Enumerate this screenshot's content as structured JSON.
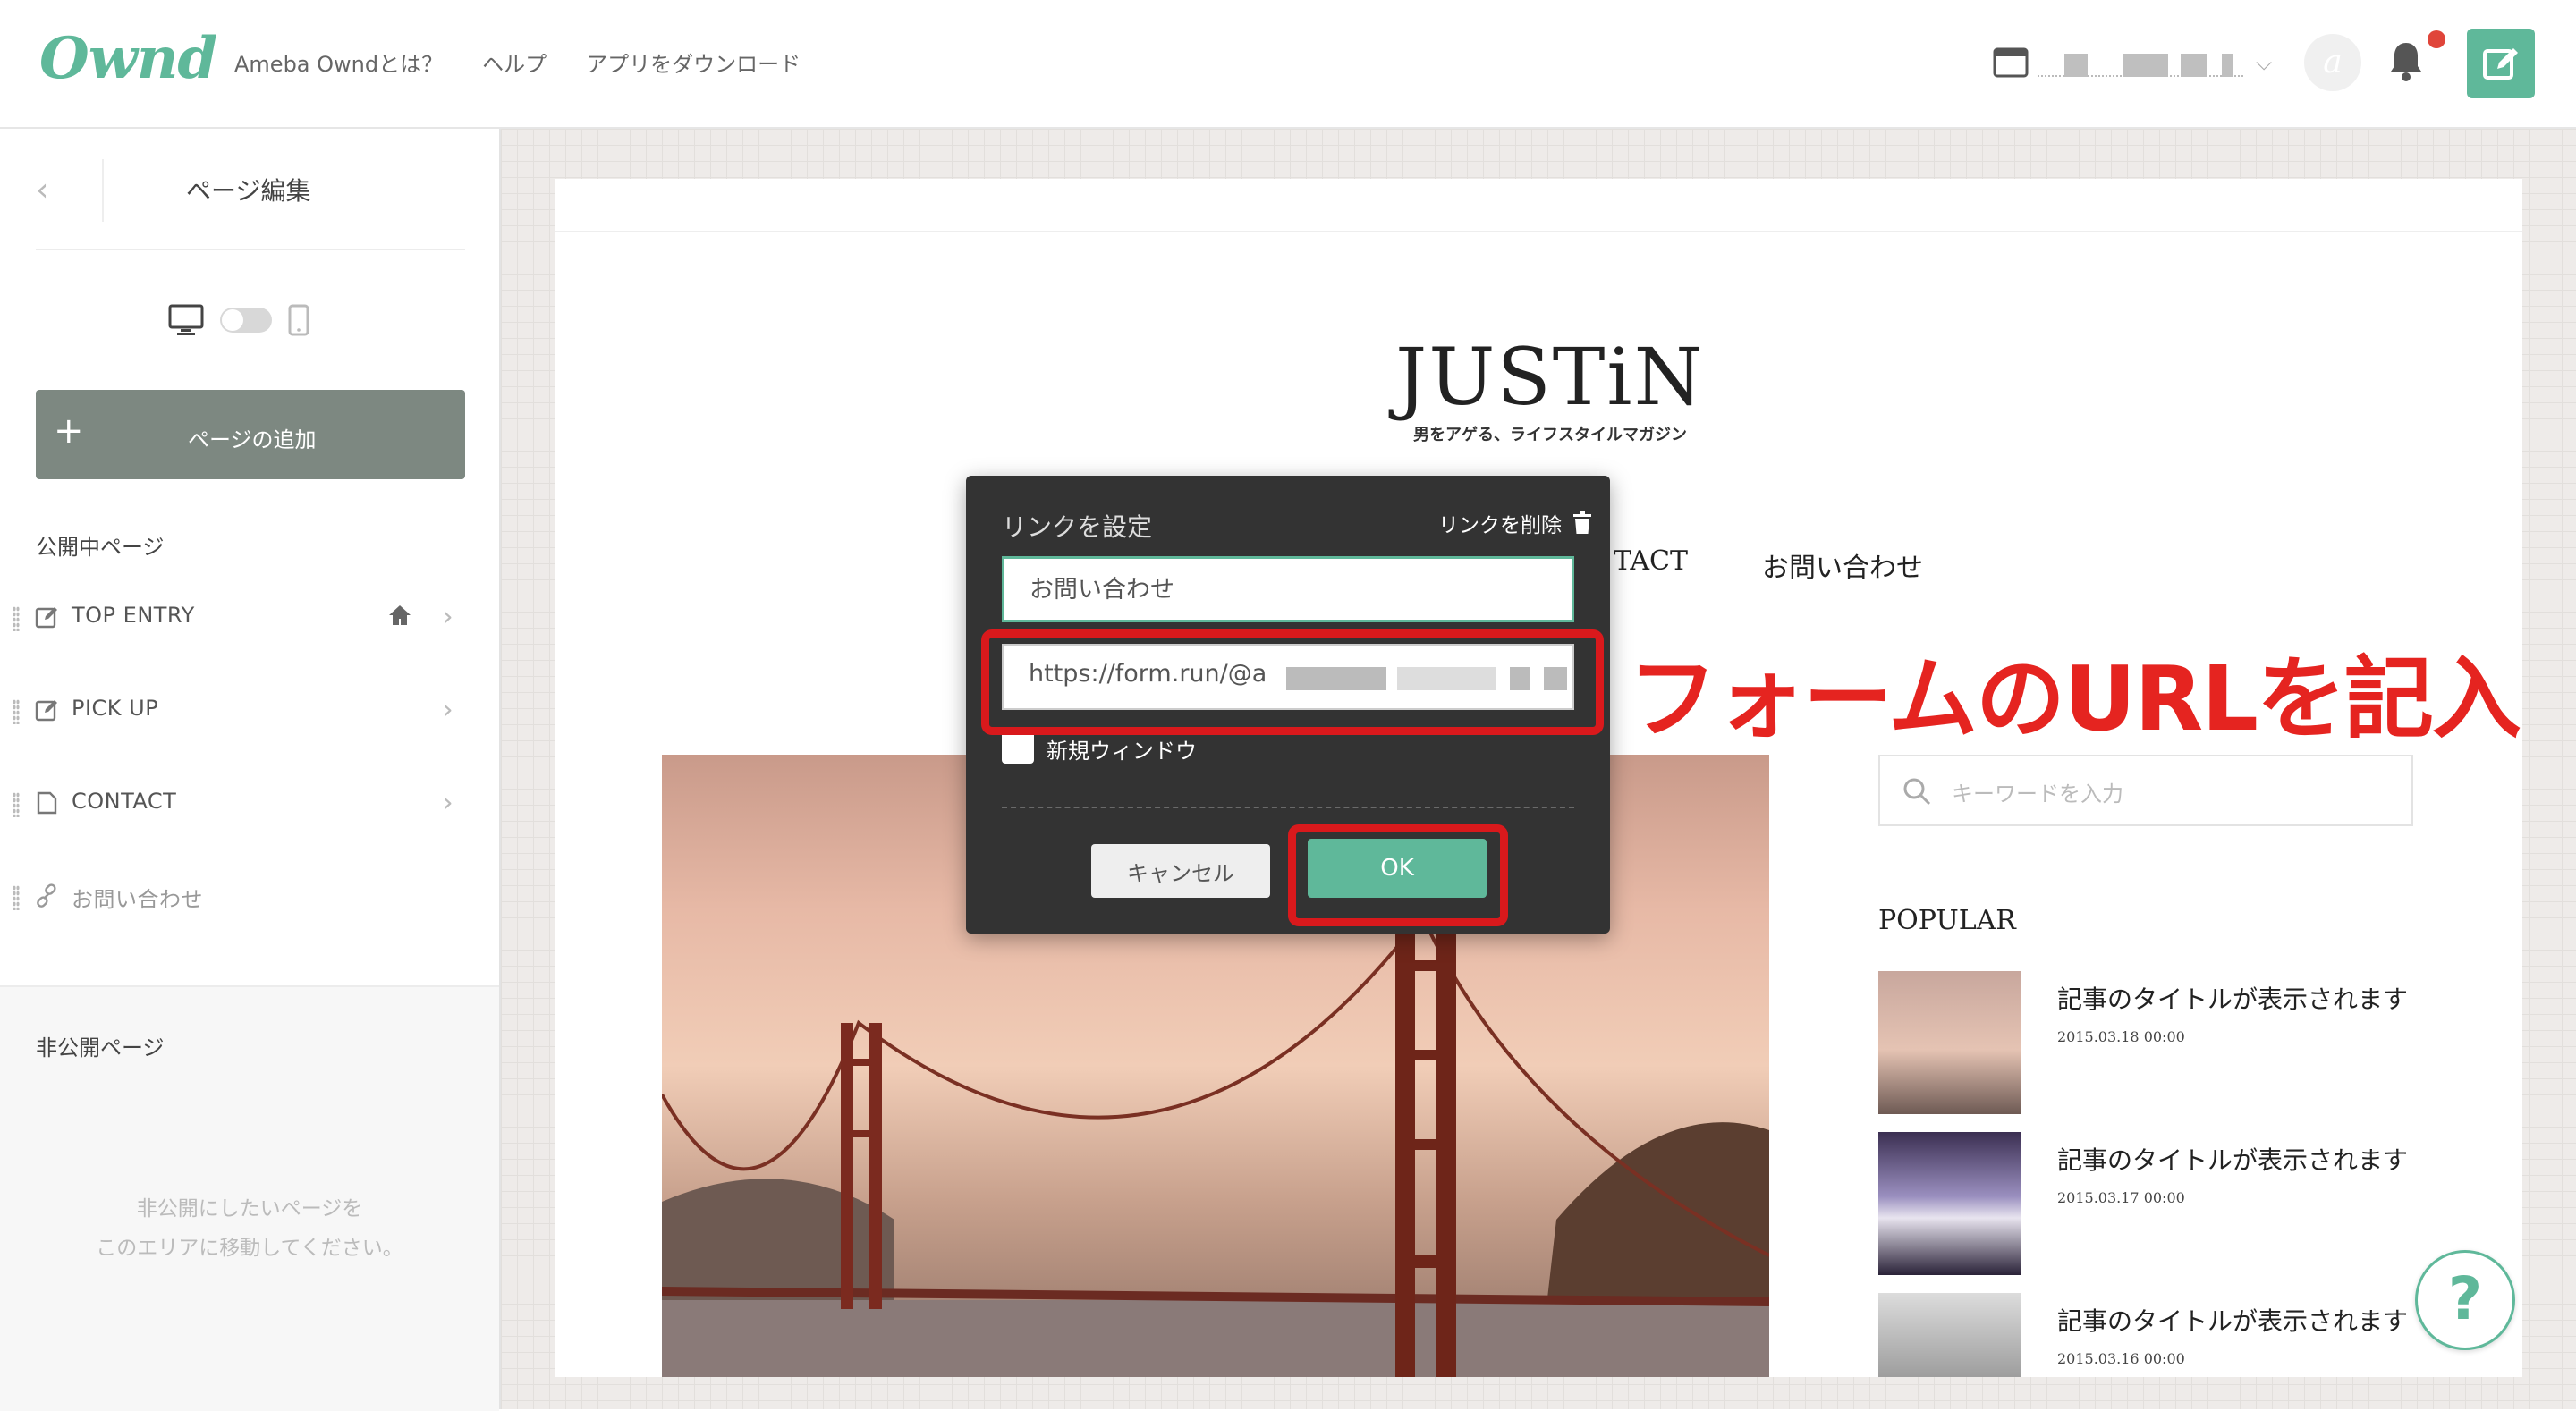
{
  "header": {
    "logo": "Ownd",
    "nav": [
      "Ameba Owndとは？",
      "ヘルプ",
      "アプリをダウンロード"
    ],
    "avatar_glyph": "a",
    "accent_color": "#5fb89a",
    "notification_dot_color": "#e0453a"
  },
  "sidebar": {
    "title": "ページ編集",
    "add_page_label": "ページの追加",
    "published_label": "公開中ページ",
    "pages": [
      {
        "label": "TOP ENTRY",
        "icon": "edit-icon",
        "is_home": true
      },
      {
        "label": "PICK UP",
        "icon": "edit-icon",
        "is_home": false
      },
      {
        "label": "CONTACT",
        "icon": "page-icon",
        "is_home": false
      },
      {
        "label": "お問い合わせ",
        "icon": "link-icon",
        "is_home": false
      }
    ],
    "unpublished_label": "非公開ページ",
    "unpublished_hint": [
      "非公開にしたいページを",
      "このエリアに移動してください。"
    ]
  },
  "preview": {
    "brand": "JUSTiN",
    "tagline": "男をアゲる、ライフスタイルマガジン",
    "nav": [
      "TACT",
      "お問い合わせ"
    ],
    "search_placeholder": "キーワードを入力",
    "popular_heading": "POPULAR",
    "articles": [
      {
        "title": "記事のタイトルが表示されます",
        "date": "2015.03.18 00:00"
      },
      {
        "title": "記事のタイトルが表示されます",
        "date": "2015.03.17 00:00"
      },
      {
        "title": "記事のタイトルが表示されます",
        "date": "2015.03.16 00:00"
      }
    ],
    "help_label": "?"
  },
  "dialog": {
    "title": "リンクを設定",
    "remove_label": "リンクを削除",
    "text_value": "お問い合わせ",
    "url_value": "https://form.run/@a",
    "new_window_label": "新規ウィンドウ",
    "cancel_label": "キャンセル",
    "ok_label": "OK"
  },
  "annotation": {
    "text": "フォームのURLを記入",
    "color": "#e52420"
  }
}
